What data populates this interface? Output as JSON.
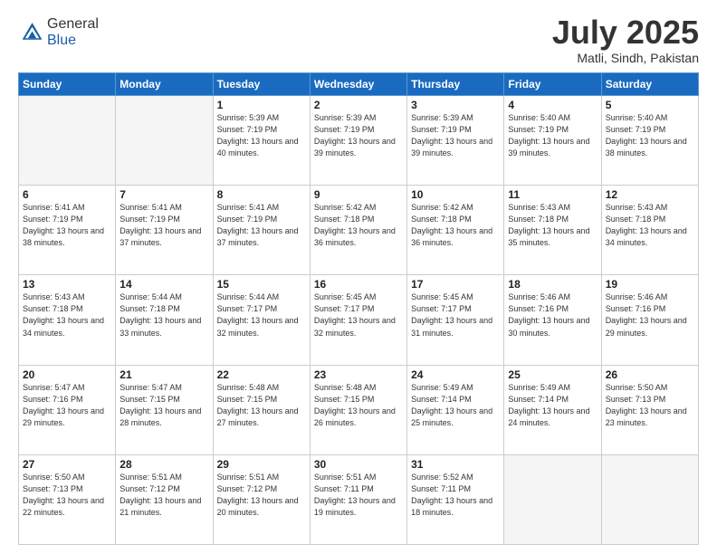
{
  "header": {
    "logo_general": "General",
    "logo_blue": "Blue",
    "month_title": "July 2025",
    "location": "Matli, Sindh, Pakistan"
  },
  "days_of_week": [
    "Sunday",
    "Monday",
    "Tuesday",
    "Wednesday",
    "Thursday",
    "Friday",
    "Saturday"
  ],
  "weeks": [
    [
      {
        "day": "",
        "info": ""
      },
      {
        "day": "",
        "info": ""
      },
      {
        "day": "1",
        "info": "Sunrise: 5:39 AM\nSunset: 7:19 PM\nDaylight: 13 hours and 40 minutes."
      },
      {
        "day": "2",
        "info": "Sunrise: 5:39 AM\nSunset: 7:19 PM\nDaylight: 13 hours and 39 minutes."
      },
      {
        "day": "3",
        "info": "Sunrise: 5:39 AM\nSunset: 7:19 PM\nDaylight: 13 hours and 39 minutes."
      },
      {
        "day": "4",
        "info": "Sunrise: 5:40 AM\nSunset: 7:19 PM\nDaylight: 13 hours and 39 minutes."
      },
      {
        "day": "5",
        "info": "Sunrise: 5:40 AM\nSunset: 7:19 PM\nDaylight: 13 hours and 38 minutes."
      }
    ],
    [
      {
        "day": "6",
        "info": "Sunrise: 5:41 AM\nSunset: 7:19 PM\nDaylight: 13 hours and 38 minutes."
      },
      {
        "day": "7",
        "info": "Sunrise: 5:41 AM\nSunset: 7:19 PM\nDaylight: 13 hours and 37 minutes."
      },
      {
        "day": "8",
        "info": "Sunrise: 5:41 AM\nSunset: 7:19 PM\nDaylight: 13 hours and 37 minutes."
      },
      {
        "day": "9",
        "info": "Sunrise: 5:42 AM\nSunset: 7:18 PM\nDaylight: 13 hours and 36 minutes."
      },
      {
        "day": "10",
        "info": "Sunrise: 5:42 AM\nSunset: 7:18 PM\nDaylight: 13 hours and 36 minutes."
      },
      {
        "day": "11",
        "info": "Sunrise: 5:43 AM\nSunset: 7:18 PM\nDaylight: 13 hours and 35 minutes."
      },
      {
        "day": "12",
        "info": "Sunrise: 5:43 AM\nSunset: 7:18 PM\nDaylight: 13 hours and 34 minutes."
      }
    ],
    [
      {
        "day": "13",
        "info": "Sunrise: 5:43 AM\nSunset: 7:18 PM\nDaylight: 13 hours and 34 minutes."
      },
      {
        "day": "14",
        "info": "Sunrise: 5:44 AM\nSunset: 7:18 PM\nDaylight: 13 hours and 33 minutes."
      },
      {
        "day": "15",
        "info": "Sunrise: 5:44 AM\nSunset: 7:17 PM\nDaylight: 13 hours and 32 minutes."
      },
      {
        "day": "16",
        "info": "Sunrise: 5:45 AM\nSunset: 7:17 PM\nDaylight: 13 hours and 32 minutes."
      },
      {
        "day": "17",
        "info": "Sunrise: 5:45 AM\nSunset: 7:17 PM\nDaylight: 13 hours and 31 minutes."
      },
      {
        "day": "18",
        "info": "Sunrise: 5:46 AM\nSunset: 7:16 PM\nDaylight: 13 hours and 30 minutes."
      },
      {
        "day": "19",
        "info": "Sunrise: 5:46 AM\nSunset: 7:16 PM\nDaylight: 13 hours and 29 minutes."
      }
    ],
    [
      {
        "day": "20",
        "info": "Sunrise: 5:47 AM\nSunset: 7:16 PM\nDaylight: 13 hours and 29 minutes."
      },
      {
        "day": "21",
        "info": "Sunrise: 5:47 AM\nSunset: 7:15 PM\nDaylight: 13 hours and 28 minutes."
      },
      {
        "day": "22",
        "info": "Sunrise: 5:48 AM\nSunset: 7:15 PM\nDaylight: 13 hours and 27 minutes."
      },
      {
        "day": "23",
        "info": "Sunrise: 5:48 AM\nSunset: 7:15 PM\nDaylight: 13 hours and 26 minutes."
      },
      {
        "day": "24",
        "info": "Sunrise: 5:49 AM\nSunset: 7:14 PM\nDaylight: 13 hours and 25 minutes."
      },
      {
        "day": "25",
        "info": "Sunrise: 5:49 AM\nSunset: 7:14 PM\nDaylight: 13 hours and 24 minutes."
      },
      {
        "day": "26",
        "info": "Sunrise: 5:50 AM\nSunset: 7:13 PM\nDaylight: 13 hours and 23 minutes."
      }
    ],
    [
      {
        "day": "27",
        "info": "Sunrise: 5:50 AM\nSunset: 7:13 PM\nDaylight: 13 hours and 22 minutes."
      },
      {
        "day": "28",
        "info": "Sunrise: 5:51 AM\nSunset: 7:12 PM\nDaylight: 13 hours and 21 minutes."
      },
      {
        "day": "29",
        "info": "Sunrise: 5:51 AM\nSunset: 7:12 PM\nDaylight: 13 hours and 20 minutes."
      },
      {
        "day": "30",
        "info": "Sunrise: 5:51 AM\nSunset: 7:11 PM\nDaylight: 13 hours and 19 minutes."
      },
      {
        "day": "31",
        "info": "Sunrise: 5:52 AM\nSunset: 7:11 PM\nDaylight: 13 hours and 18 minutes."
      },
      {
        "day": "",
        "info": ""
      },
      {
        "day": "",
        "info": ""
      }
    ]
  ]
}
